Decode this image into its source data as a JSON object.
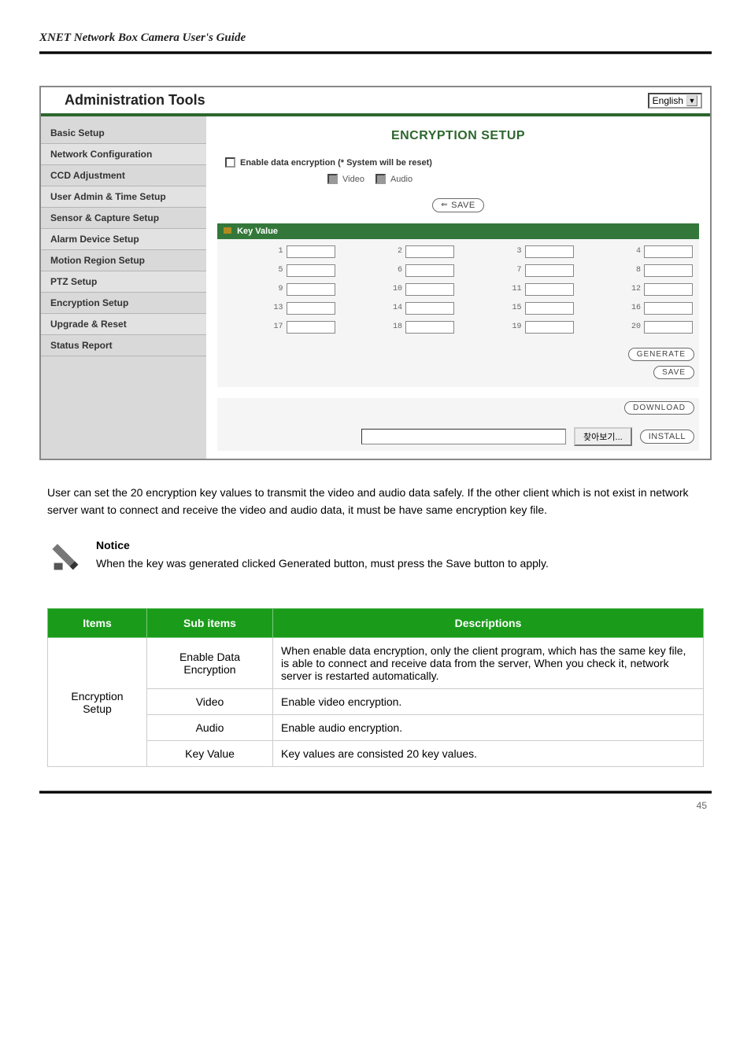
{
  "doc": {
    "title": "XNET Network Box Camera User's Guide",
    "page_number": "45"
  },
  "admin": {
    "header_title": "Administration Tools",
    "language": "English",
    "sidebar": {
      "items": [
        {
          "label": "Basic Setup"
        },
        {
          "label": "Network Configuration"
        },
        {
          "label": "CCD Adjustment"
        },
        {
          "label": "User Admin & Time Setup"
        },
        {
          "label": "Sensor & Capture Setup"
        },
        {
          "label": "Alarm Device Setup"
        },
        {
          "label": "Motion Region Setup"
        },
        {
          "label": "PTZ Setup"
        },
        {
          "label": "Encryption Setup"
        },
        {
          "label": "Upgrade & Reset"
        },
        {
          "label": "Status Report"
        }
      ]
    },
    "content": {
      "title": "ENCRYPTION SETUP",
      "enable_label": "Enable data encryption (* System will be reset)",
      "video_label": "Video",
      "audio_label": "Audio",
      "save_btn": "SAVE",
      "key_value_label": "Key Value",
      "kv": [
        "1",
        "2",
        "3",
        "4",
        "5",
        "6",
        "7",
        "8",
        "9",
        "10",
        "11",
        "12",
        "13",
        "14",
        "15",
        "16",
        "17",
        "18",
        "19",
        "20"
      ],
      "generate_btn": "GENERATE",
      "save_btn2": "SAVE",
      "download_btn": "DOWNLOAD",
      "browse_btn": "찾아보기...",
      "install_btn": "INSTALL"
    }
  },
  "body": {
    "para1": "User can set the 20 encryption key values to transmit the video and audio data safely. If the other client which is not exist in network server want to connect and receive the video and audio data, it must be have same encryption key file.",
    "notice": {
      "head": "Notice",
      "text": "When the key was generated clicked Generated button, must press the Save button to apply."
    }
  },
  "table": {
    "headers": [
      "Items",
      "Sub items",
      "Descriptions"
    ],
    "rows": [
      {
        "c0": "Encryption Setup",
        "c0_rowspan": 4,
        "c1": "Enable Data Encryption",
        "c2": "When enable data encryption, only the client program, which has the same key file, is able to connect and receive data from the server, When you check it, network server is restarted automatically."
      },
      {
        "c1": "Video",
        "c2": "Enable video encryption."
      },
      {
        "c1": "Audio",
        "c2": "Enable audio encryption."
      },
      {
        "c1": "Key Value",
        "c2": "Key values are consisted 20 key values."
      }
    ]
  }
}
